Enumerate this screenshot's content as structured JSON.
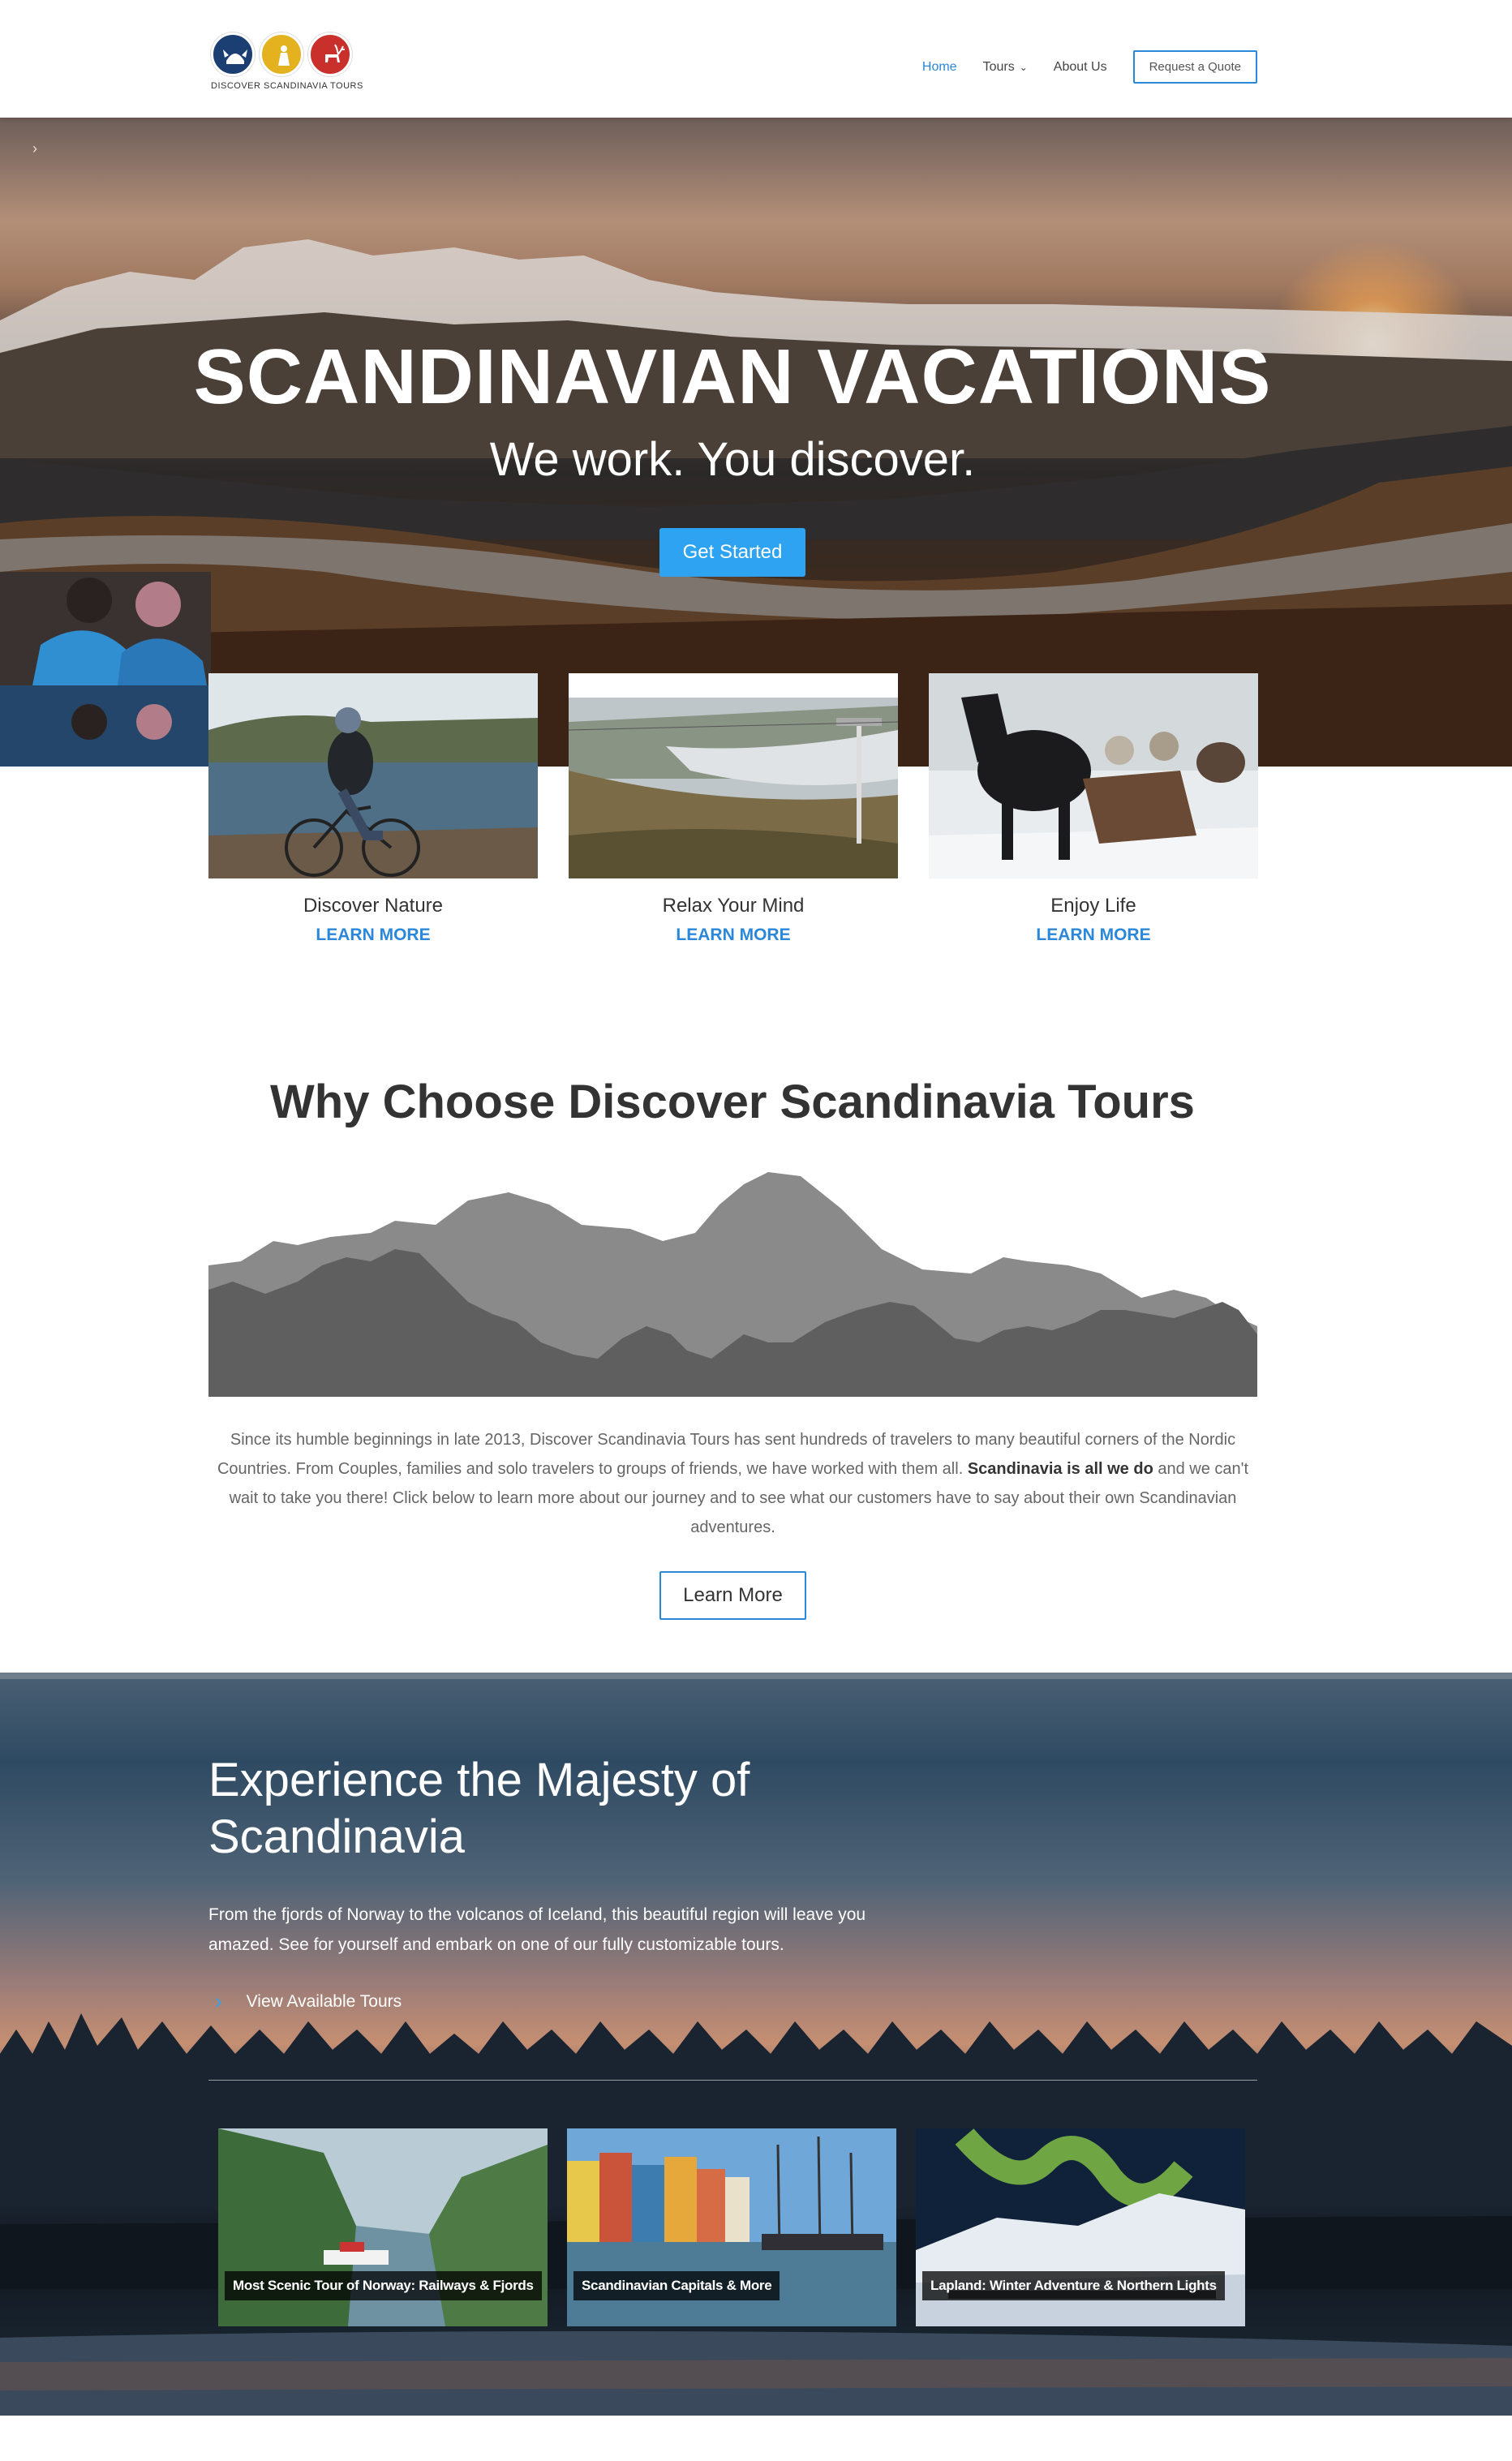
{
  "brand": {
    "logo_text": "DISCOVER SCANDINAVIA TOURS"
  },
  "nav": {
    "items": [
      {
        "label": "Home",
        "active": true
      },
      {
        "label": "Tours",
        "has_dropdown": true
      },
      {
        "label": "About Us"
      }
    ],
    "quote_button": "Request a Quote"
  },
  "hero": {
    "title": "SCANDINAVIAN VACATIONS",
    "tagline": "We work. You discover.",
    "cta": "Get Started",
    "arrow": "›"
  },
  "features": [
    {
      "label": "Discover Nature",
      "link": "LEARN MORE"
    },
    {
      "label": "Relax Your Mind",
      "link": "LEARN MORE"
    },
    {
      "label": "Enjoy Life",
      "link": "LEARN MORE"
    }
  ],
  "why": {
    "title": "Why Choose Discover Scandinavia Tours",
    "text_part1": "Since its humble beginnings in late 2013, Discover Scandinavia Tours has sent hundreds of travelers to many beautiful corners of the Nordic Countries. From Couples, families and solo travelers to groups of friends, we have worked with them all. ",
    "text_bold": "Scandinavia is all we do",
    "text_part2": " and we can't wait to take you there! Click below to learn more about our journey and to see what our customers have to say about their own Scandinavian adventures.",
    "button": "Learn More"
  },
  "majesty": {
    "title": "Experience the Majesty of Scandinavia",
    "description": "From the fjords of Norway to the volcanos of Iceland, this beautiful region will leave you amazed. See for yourself and embark on one of our fully customizable tours.",
    "link": "View Available Tours",
    "link_arrow": "›",
    "tours": [
      {
        "caption": "Most Scenic Tour of Norway: Railways & Fjords"
      },
      {
        "caption": "Scandinavian Capitals & More"
      },
      {
        "caption": "Lapland: Winter Adventure & Northern Lights"
      }
    ]
  },
  "colors": {
    "accent": "#2ea3f2",
    "link": "#2b87da",
    "text": "#333333"
  }
}
